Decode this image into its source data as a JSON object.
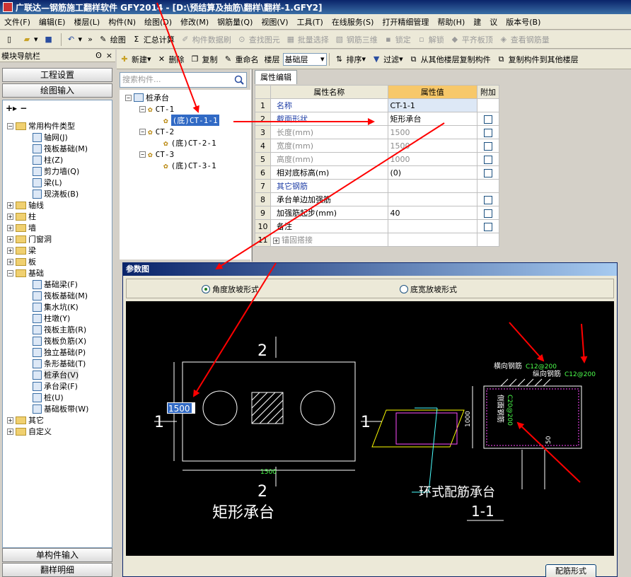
{
  "title": "广联达—钢筋施工翻样软件 GFY2014 - [D:\\预结算及抽筋\\翻样\\翻样-1.GFY2]",
  "menu": [
    "文件(F)",
    "编辑(E)",
    "楼层(L)",
    "构件(N)",
    "绘图(D)",
    "修改(M)",
    "钢筋量(Q)",
    "视图(V)",
    "工具(T)",
    "在线服务(S)",
    "打开精细管理",
    "帮助(H)",
    "建",
    "议",
    "版本号(B)"
  ],
  "toolbar1": {
    "draw": "绘图",
    "sum": "汇总计算",
    "brush": "构件数据刷",
    "find": "查找图元",
    "batch": "批量选择",
    "rebar3d": "钢筋三维",
    "lock": "锁定",
    "unlock": "解锁",
    "flat": "平齐板顶",
    "view_rebar": "查看钢筋量"
  },
  "nav": {
    "title": "模块导航栏",
    "pin": "ʘ",
    "close": "×",
    "btn_project": "工程设置",
    "btn_draw": "绘图输入",
    "btn_single": "单构件输入",
    "btn_detail": "翻样明细",
    "tree": [
      "常用构件类型",
      "轴网(J)",
      "筏板基础(M)",
      "柱(Z)",
      "剪力墙(Q)",
      "梁(L)",
      "现浇板(B)",
      "轴线",
      "柱",
      "墙",
      "门窗洞",
      "梁",
      "板",
      "基础",
      "基础梁(F)",
      "筏板基础(M)",
      "集水坑(K)",
      "柱墩(Y)",
      "筏板主筋(R)",
      "筏板负筋(X)",
      "独立基础(P)",
      "条形基础(T)",
      "桩承台(V)",
      "承台梁(F)",
      "桩(U)",
      "基础板带(W)",
      "其它",
      "自定义"
    ]
  },
  "midbar": {
    "new": "新建",
    "delete": "删除",
    "copy": "复制",
    "rename": "重命名",
    "floor_label": "楼层",
    "floor_value": "基础层",
    "sort": "排序",
    "filter": "过滤",
    "copy_from": "从其他楼层复制构件",
    "copy_to": "复制构件到其他楼层"
  },
  "search": {
    "placeholder": "搜索构件..."
  },
  "comptree": [
    "桩承台",
    "CT-1",
    "(底)CT-1-1",
    "CT-2",
    "(底)CT-2-1",
    "CT-3",
    "(底)CT-3-1"
  ],
  "props": {
    "tab": "属性编辑",
    "headers": [
      "属性名称",
      "属性值",
      "附加"
    ],
    "rows": [
      {
        "n": "1",
        "name": "名称",
        "value": "CT-1-1"
      },
      {
        "n": "2",
        "name": "截面形状",
        "value": "矩形承台"
      },
      {
        "n": "3",
        "name": "长度(mm)",
        "value": "1500"
      },
      {
        "n": "4",
        "name": "宽度(mm)",
        "value": "1500"
      },
      {
        "n": "5",
        "name": "高度(mm)",
        "value": "1000"
      },
      {
        "n": "6",
        "name": "相对底标高(m)",
        "value": "(0)"
      },
      {
        "n": "7",
        "name": "其它钢筋",
        "value": ""
      },
      {
        "n": "8",
        "name": "承台单边加强筋",
        "value": ""
      },
      {
        "n": "9",
        "name": "加强筋起步(mm)",
        "value": "40"
      },
      {
        "n": "10",
        "name": "备注",
        "value": ""
      },
      {
        "n": "11",
        "name": "锚固搭接",
        "value": ""
      }
    ]
  },
  "dialog": {
    "title": "参数图",
    "radio1": "角度放坡形式",
    "radio2": "底宽放坡形式",
    "button": "配筋形式",
    "drawing": {
      "sec2_top": "2",
      "sec2_bottom": "2",
      "sec1_left": "1",
      "sec1_right": "1",
      "width_input": "1500",
      "dim_bottom": "1500",
      "left_title": "矩形承台",
      "right_title": "环式配筋承台",
      "right_sub": "1-1",
      "horiz_label": "横向钢筋",
      "horiz_value": "C12@200",
      "vert_label": "纵向钢筋",
      "vert_value": "C12@200",
      "side_label": "侧面钢筋",
      "side_value": "C20@200",
      "height_dim": "1000",
      "small_dim": "50"
    }
  }
}
